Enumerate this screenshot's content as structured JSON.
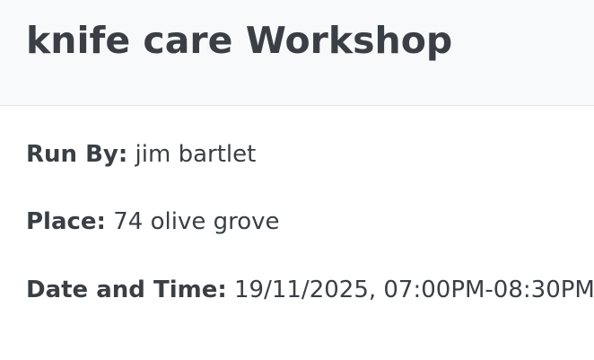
{
  "header": {
    "title": "knife care Workshop"
  },
  "details": {
    "run_by": {
      "label": "Run By:",
      "value": "jim bartlet"
    },
    "place": {
      "label": "Place:",
      "value": "74 olive grove"
    },
    "date_time": {
      "label": "Date and Time:",
      "value": "19/11/2025, 07:00PM-08:30PM"
    }
  },
  "colors": {
    "header_background": "#f8f9fa",
    "text": "#3a3f45",
    "divider": "#e2e5e8"
  }
}
